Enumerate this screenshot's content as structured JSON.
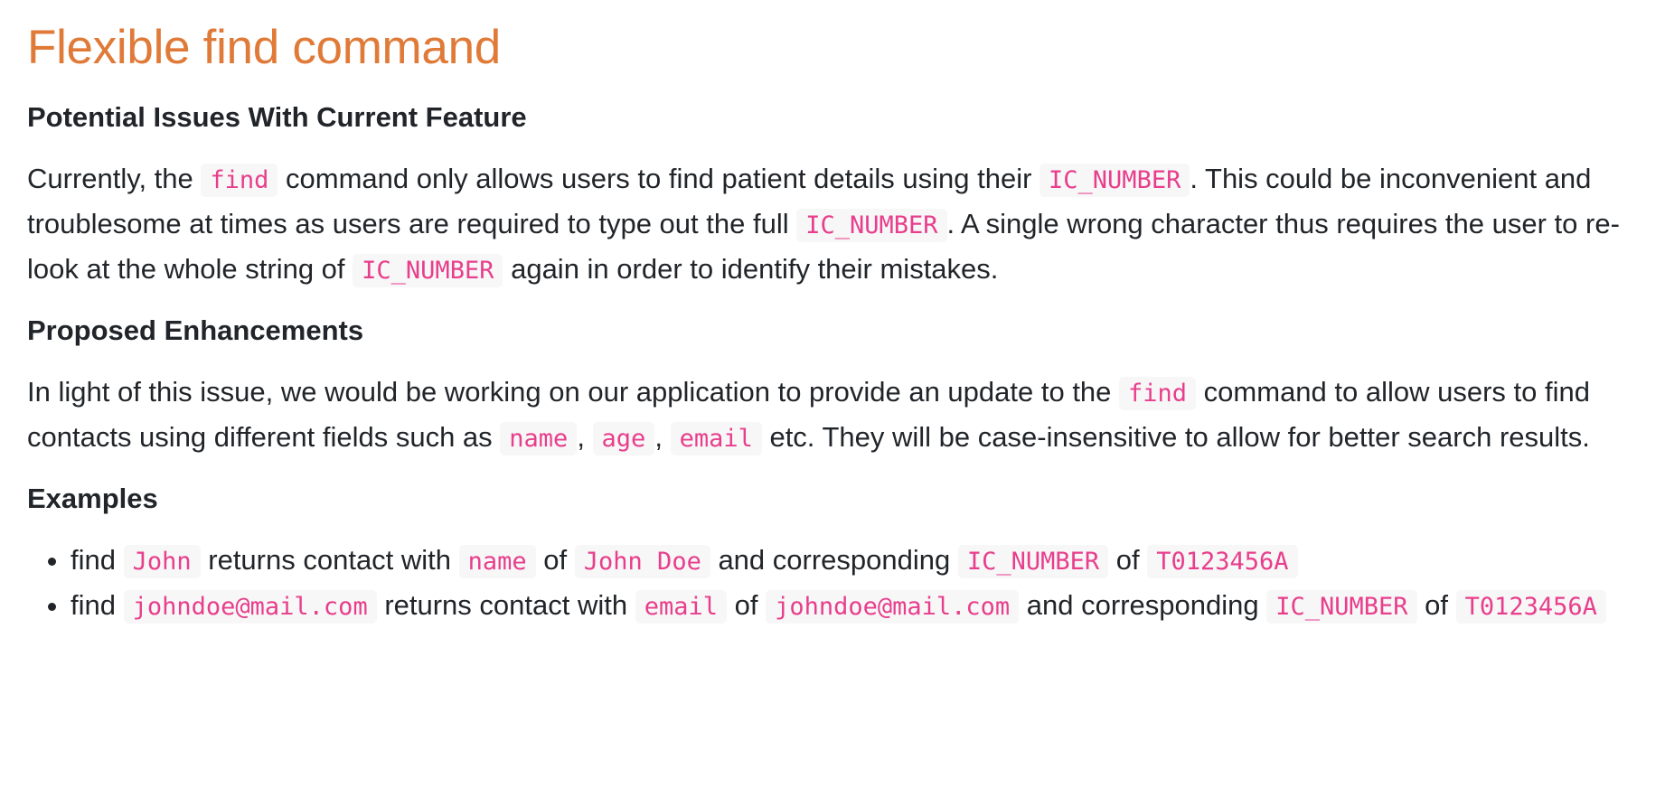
{
  "title": "Flexible find command",
  "issues": {
    "heading": "Potential Issues With Current Feature",
    "t1": "Currently, the ",
    "c1": "find",
    "t2": " command only allows users to find patient details using their ",
    "c2": "IC_NUMBER",
    "t3": ". This could be inconvenient and troublesome at times as users are required to type out the full ",
    "c3": "IC_NUMBER",
    "t4": ". A single wrong character thus requires the user to re-look at the whole string of ",
    "c4": "IC_NUMBER",
    "t5": " again in order to identify their mistakes."
  },
  "enhancements": {
    "heading": "Proposed Enhancements",
    "t1": "In light of this issue, we would be working on our application to provide an update to the ",
    "c1": "find",
    "t2": " command to allow users to find contacts using different fields such as ",
    "c2": "name",
    "t3": ", ",
    "c3": "age",
    "t4": ", ",
    "c4": "email",
    "t5": " etc. They will be case-insensitive to allow for better search results."
  },
  "examples": {
    "heading": "Examples",
    "items": [
      {
        "t1": "find ",
        "c1": "John",
        "t2": " returns contact with ",
        "c2": "name",
        "t3": " of ",
        "c3": "John Doe",
        "t4": " and corresponding ",
        "c4": "IC_NUMBER",
        "t5": " of ",
        "c5": "T0123456A"
      },
      {
        "t1": "find ",
        "c1": "johndoe@mail.com",
        "t2": " returns contact with ",
        "c2": "email",
        "t3": " of ",
        "c3": "johndoe@mail.com",
        "t4": " and corresponding ",
        "c4": "IC_NUMBER",
        "t5": " of ",
        "c5": "T0123456A"
      }
    ]
  },
  "colors": {
    "title": "#e07a38",
    "code_text": "#e83e8c",
    "code_background": "#f7f7f7",
    "body_text": "#212529"
  }
}
